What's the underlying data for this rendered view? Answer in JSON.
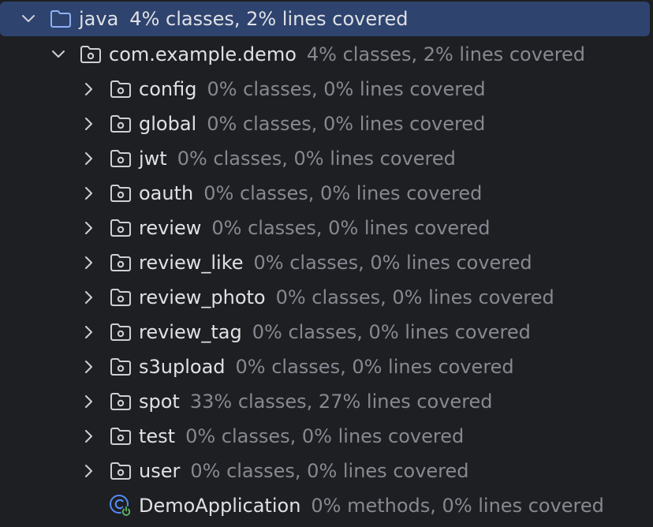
{
  "tree": {
    "root": {
      "name": "java",
      "coverage": "4% classes, 2% lines covered",
      "icon": "folder-icon",
      "expanded": true,
      "selected": true
    },
    "package": {
      "name": "com.example.demo",
      "coverage": "4% classes, 2% lines covered",
      "icon": "package-icon",
      "expanded": true
    },
    "subpackages": [
      {
        "name": "config",
        "coverage": "0% classes, 0% lines covered"
      },
      {
        "name": "global",
        "coverage": "0% classes, 0% lines covered"
      },
      {
        "name": "jwt",
        "coverage": "0% classes, 0% lines covered"
      },
      {
        "name": "oauth",
        "coverage": "0% classes, 0% lines covered"
      },
      {
        "name": "review",
        "coverage": "0% classes, 0% lines covered"
      },
      {
        "name": "review_like",
        "coverage": "0% classes, 0% lines covered"
      },
      {
        "name": "review_photo",
        "coverage": "0% classes, 0% lines covered"
      },
      {
        "name": "review_tag",
        "coverage": "0% classes, 0% lines covered"
      },
      {
        "name": "s3upload",
        "coverage": "0% classes, 0% lines covered"
      },
      {
        "name": "spot",
        "coverage": "33% classes, 27% lines covered"
      },
      {
        "name": "test",
        "coverage": "0% classes, 0% lines covered"
      },
      {
        "name": "user",
        "coverage": "0% classes, 0% lines covered"
      }
    ],
    "class_item": {
      "name": "DemoApplication",
      "coverage": "0% methods, 0% lines covered",
      "icon": "spring-boot-class-icon"
    }
  },
  "colors": {
    "background": "#1e1f22",
    "selection": "#2e436e",
    "text": "#dfe1e5",
    "secondary_text": "#868991",
    "folder_blue": "#8fb0f7",
    "icon_gray": "#ced0d6",
    "class_blue": "#548af7",
    "spring_green": "#5fb865"
  }
}
